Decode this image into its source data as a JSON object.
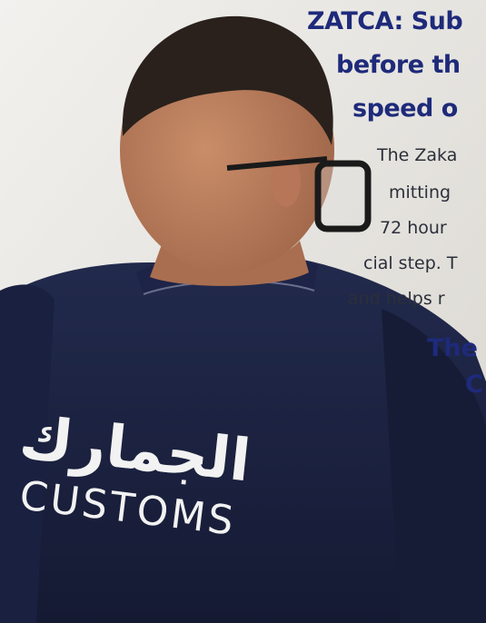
{
  "article": {
    "headline_lines": [
      "ZATCA: Sub",
      "before th",
      "speed o"
    ],
    "body_lines": [
      "The Zaka",
      "mitting",
      "72 hour",
      "cial step. T",
      "and helps r"
    ],
    "subhead_lines": [
      "The",
      "C"
    ]
  },
  "photo": {
    "shirt_text_arabic": "الجمارك",
    "shirt_text_latin": "CUSTOMS",
    "colors": {
      "background": "#e9e7e2",
      "shirt": "#1b2140",
      "skin": "#b47a58",
      "hair": "#2a211c",
      "headline": "#1e2a7a"
    }
  }
}
